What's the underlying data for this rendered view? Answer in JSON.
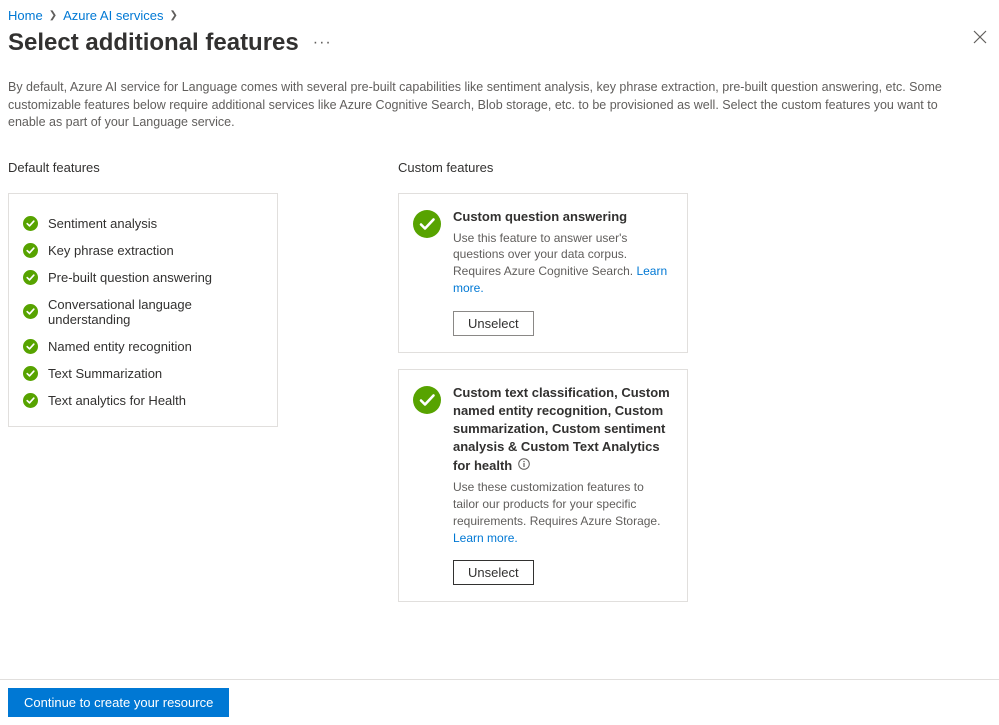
{
  "breadcrumb": {
    "items": [
      "Home",
      "Azure AI services"
    ]
  },
  "page": {
    "title": "Select additional features",
    "description": "By default, Azure AI service for Language comes with several pre-built capabilities like sentiment analysis, key phrase extraction, pre-built question answering, etc. Some customizable features below require additional services like Azure Cognitive Search, Blob storage, etc. to be provisioned as well. Select the custom features you want to enable as part of your Language service."
  },
  "default": {
    "header": "Default features",
    "items": [
      {
        "label": "Sentiment analysis"
      },
      {
        "label": "Key phrase extraction"
      },
      {
        "label": "Pre-built question answering"
      },
      {
        "label": "Conversational language understanding"
      },
      {
        "label": "Named entity recognition"
      },
      {
        "label": "Text Summarization"
      },
      {
        "label": "Text analytics for Health"
      }
    ]
  },
  "custom": {
    "header": "Custom features",
    "cards": [
      {
        "title": "Custom question answering",
        "description": "Use this feature to answer user's questions over your data corpus. Requires Azure Cognitive Search. ",
        "learn_more": "Learn more.",
        "button": "Unselect",
        "info": false
      },
      {
        "title": "Custom text classification, Custom named entity recognition, Custom summarization, Custom sentiment analysis & Custom Text Analytics for health",
        "description": "Use these customization features to tailor our products for your specific requirements. Requires Azure Storage. ",
        "learn_more": "Learn more.",
        "button": "Unselect",
        "info": true
      }
    ]
  },
  "footer": {
    "continue": "Continue to create your resource"
  },
  "colors": {
    "green": "#57a300",
    "link": "#0078d4"
  }
}
